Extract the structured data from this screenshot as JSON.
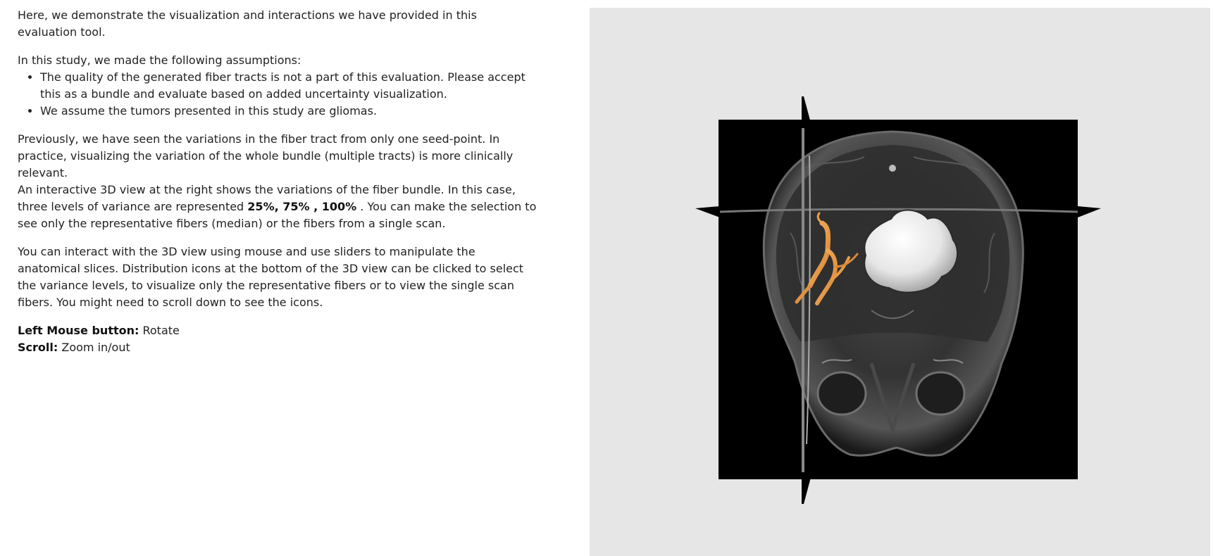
{
  "intro": "Here, we demonstrate the visualization and interactions we have provided in this evaluation tool.",
  "assumptions": {
    "heading": "In this study, we made the following assumptions:",
    "items": [
      "The quality of the generated fiber tracts is not a part of this evaluation. Please accept this as a bundle and evaluate based on added uncertainty visualization.",
      "We assume the tumors presented in this study are gliomas."
    ]
  },
  "bundle_text": {
    "line1": "Previously, we have seen the variations in the fiber tract from only one seed-point. In practice, visualizing the variation of the whole bundle (multiple tracts) is more clinically relevant.",
    "line2_before": "An interactive 3D view at the right shows the variations of the fiber bundle. In this case, three levels of variance are represented ",
    "line2_bold": "25%, 75% , 100%",
    "line2_after": " . You can make the selection to see only the representative fibers (median) or the fibers from a single scan."
  },
  "interaction_text": "You can interact with the 3D view using mouse and use sliders to manipulate the anatomical slices. Distribution icons at the bottom of the 3D view can be clicked to select the variance levels, to visualize only the representative fibers or to view the single scan fibers. You might need to scroll down to see the icons.",
  "controls": [
    {
      "key": "Left Mouse button:",
      "action": " Rotate"
    },
    {
      "key": "Scroll:",
      "action": " Zoom in/out"
    }
  ],
  "colors": {
    "viewer_bg": "#e6e6e6",
    "fiber_bundle": "#f0a050",
    "tumor": "#f2f2f2"
  }
}
